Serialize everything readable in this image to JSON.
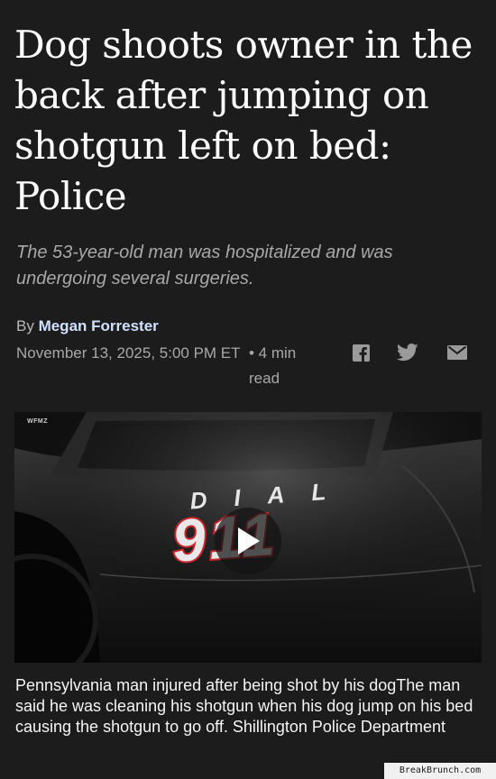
{
  "article": {
    "headline": "Dog shoots owner in the back after jumping on shotgun left on bed: Police",
    "dek": "The 53-year-old man was hospitalized and was undergoing several surgeries.",
    "byline_prefix": "By ",
    "author": "Megan Forrester",
    "date": "November 13, 2025, 5:00 PM ET",
    "read_time": "• 4 min read"
  },
  "share": {
    "icons": [
      "facebook-icon",
      "twitter-icon",
      "email-icon"
    ]
  },
  "media": {
    "watermark": "WFMZ",
    "decal_top": "DIAL",
    "decal_number": "911",
    "play_icon": "play-icon"
  },
  "caption": "Pennsylvania man injured after being shot by his dogThe man said he was cleaning his shotgun when his dog jump on his bed causing the shotgun to go off. Shillington Police Department",
  "footer": {
    "credit": "BreakBrunch.com"
  },
  "colors": {
    "background": "#1c1c1c",
    "author_link": "#cfe1ff",
    "decal_red": "#c8252d"
  }
}
